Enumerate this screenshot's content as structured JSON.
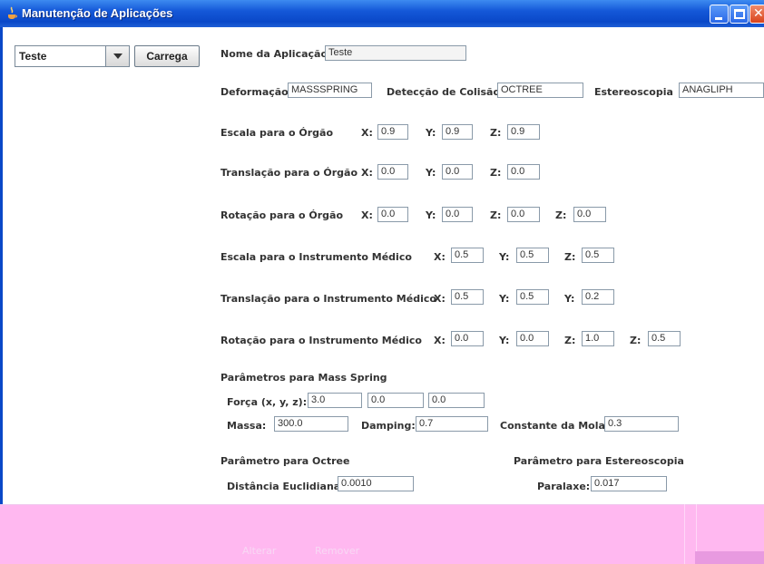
{
  "window": {
    "title": "Manutenção de Aplicações",
    "close_glyph": "✕"
  },
  "left": {
    "combo_value": "Teste",
    "load_button": "Carrega"
  },
  "form": {
    "app_name_label": "Nome da Aplicação",
    "app_name_value": "Teste",
    "deformation_label": "Deformação",
    "deformation_value": "MASSSPRING",
    "collision_label": "Detecção de Colisão",
    "collision_value": "OCTREE",
    "stereo_label": "Estereoscopia",
    "stereo_value": "ANAGLIPH",
    "rows": [
      {
        "label": "Escala para o Órgão",
        "fields": [
          {
            "axis": "X:",
            "value": "0.9"
          },
          {
            "axis": "Y:",
            "value": "0.9"
          },
          {
            "axis": "Z:",
            "value": "0.9"
          }
        ]
      },
      {
        "label": "Translação para o Órgão",
        "fields": [
          {
            "axis": "X:",
            "value": "0.0"
          },
          {
            "axis": "Y:",
            "value": "0.0"
          },
          {
            "axis": "Z:",
            "value": "0.0"
          }
        ]
      },
      {
        "label": "Rotação para o Órgão",
        "fields": [
          {
            "axis": "X:",
            "value": "0.0"
          },
          {
            "axis": "Y:",
            "value": "0.0"
          },
          {
            "axis": "Z:",
            "value": "0.0"
          },
          {
            "axis": "Z:",
            "value": "0.0"
          }
        ]
      },
      {
        "label": "Escala para o Instrumento Médico",
        "fields": [
          {
            "axis": "X:",
            "value": "0.5"
          },
          {
            "axis": "Y:",
            "value": "0.5"
          },
          {
            "axis": "Z:",
            "value": "0.5"
          }
        ]
      },
      {
        "label": "Translação para o Instrumento Médico",
        "fields": [
          {
            "axis": "X:",
            "value": "0.5"
          },
          {
            "axis": "Y:",
            "value": "0.5"
          },
          {
            "axis": "Y:",
            "value": "0.2"
          }
        ]
      },
      {
        "label": "Rotação para o Instrumento Médico",
        "fields": [
          {
            "axis": "X:",
            "value": "0.0"
          },
          {
            "axis": "Y:",
            "value": "0.0"
          },
          {
            "axis": "Z:",
            "value": "1.0"
          },
          {
            "axis": "Z:",
            "value": "0.5"
          }
        ]
      }
    ],
    "mass_spring": {
      "title": "Parâmetros para Mass Spring",
      "force_label": "Força (x, y, z):",
      "force_values": [
        "3.0",
        "0.0",
        "0.0"
      ],
      "mass_label": "Massa:",
      "mass_value": "300.0",
      "damping_label": "Damping:",
      "damping_value": "0.7",
      "spring_label": "Constante da Mola:",
      "spring_value": "0.3"
    },
    "octree": {
      "title": "Parâmetro para Octree",
      "dist_label": "Distância Euclidiana:",
      "dist_value": "0.0010"
    },
    "stereo_params": {
      "title": "Parâmetro para Estereoscopia",
      "parallax_label": "Paralaxe:",
      "parallax_value": "0.017"
    }
  },
  "footer": {
    "alter_button": "Alterar",
    "remove_button": "Remover"
  }
}
